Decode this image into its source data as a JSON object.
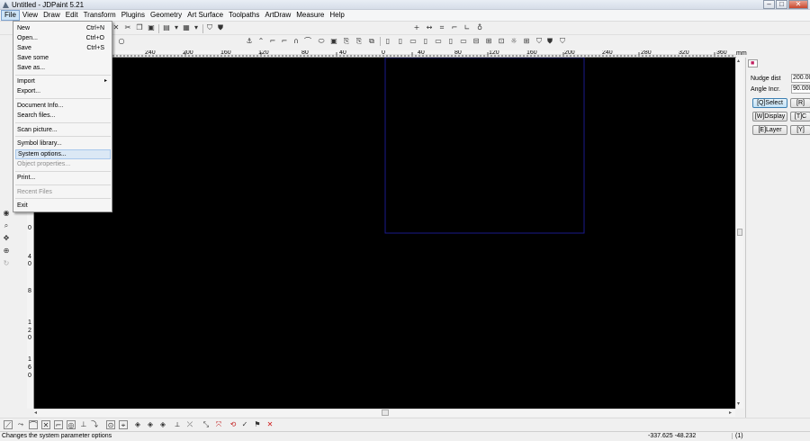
{
  "window": {
    "title": "Untitled - JDPaint 5.21"
  },
  "window_controls": {
    "minimize": "–",
    "maximize": "□",
    "close": "✕"
  },
  "menubar": [
    "File",
    "View",
    "Draw",
    "Edit",
    "Transform",
    "Plugins",
    "Geometry",
    "Art Surface",
    "Toolpaths",
    "ArtDraw",
    "Measure",
    "Help"
  ],
  "active_menu": "File",
  "file_menu": [
    {
      "label": "New",
      "shortcut": "Ctrl+N"
    },
    {
      "label": "Open...",
      "shortcut": "Ctrl+O"
    },
    {
      "label": "Save",
      "shortcut": "Ctrl+S"
    },
    {
      "label": "Save some",
      "shortcut": ""
    },
    {
      "label": "Save as...",
      "shortcut": ""
    },
    {
      "separator": true
    },
    {
      "label": "Import",
      "shortcut": "",
      "submenu": true
    },
    {
      "label": "Export...",
      "shortcut": ""
    },
    {
      "separator": true
    },
    {
      "label": "Document Info...",
      "shortcut": ""
    },
    {
      "label": "Search files...",
      "shortcut": ""
    },
    {
      "separator": true
    },
    {
      "label": "Scan picture...",
      "shortcut": ""
    },
    {
      "separator": true
    },
    {
      "label": "Symbol library...",
      "shortcut": ""
    },
    {
      "label": "System options...",
      "shortcut": "",
      "hover": true
    },
    {
      "label": "Object properties...",
      "shortcut": "",
      "disabled": true
    },
    {
      "separator": true
    },
    {
      "label": "Print...",
      "shortcut": ""
    },
    {
      "separator": true
    },
    {
      "label": "Recent Files",
      "shortcut": "",
      "disabled": true
    },
    {
      "separator": true
    },
    {
      "label": "Exit",
      "shortcut": ""
    }
  ],
  "ruler": {
    "h_labels": [
      "240",
      "200",
      "160",
      "120",
      "80",
      "40",
      "0",
      "40",
      "80",
      "120",
      "160",
      "200",
      "240",
      "280",
      "320",
      "360"
    ],
    "unit_label": "mm",
    "v_labels": [
      "0",
      "4",
      "0",
      "8",
      "1",
      "2",
      "0",
      "1",
      "6",
      "0"
    ]
  },
  "right_panel": {
    "nudge_label": "Nudge dist",
    "nudge_value": "200.00",
    "angle_label": "Angle Incr.",
    "angle_value": "90.000",
    "buttons": [
      {
        "label": "[Q]Select",
        "selected": true
      },
      {
        "label": "[R]",
        "selected": false
      },
      {
        "label": "[W]Display",
        "selected": false
      },
      {
        "label": "[T]C",
        "selected": false
      },
      {
        "label": "[E]Layer",
        "selected": false
      },
      {
        "label": "[Y]",
        "selected": false
      }
    ]
  },
  "statusbar": {
    "message": "Changes the system parameter options",
    "coords": "-337.625 -48.232",
    "extra": "(1)"
  },
  "colors": {
    "canvas": "#000000",
    "drawing_rect_stroke": "#1a1a8c",
    "close_icon_color": "#d01818",
    "accent": "#cde4f7"
  },
  "icons": {
    "app": "jdpaint-logo-icon",
    "delete": "red-x-icon"
  }
}
